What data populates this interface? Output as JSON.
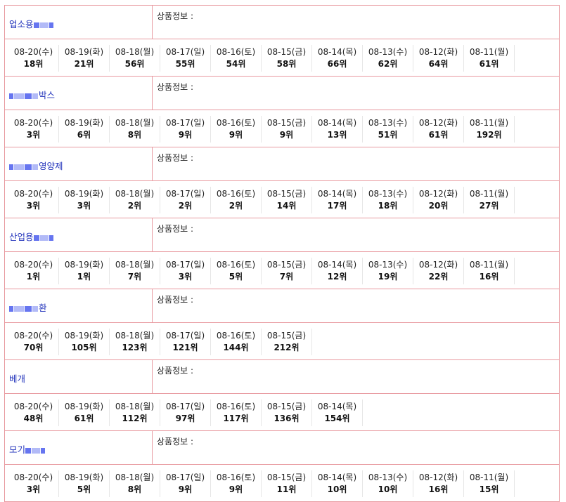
{
  "info_label": "상품정보 :",
  "blocks": [
    {
      "name": "업소용",
      "obscured_suffix": true,
      "ranks": [
        {
          "date": "08-20(수)",
          "rank": "18위"
        },
        {
          "date": "08-19(화)",
          "rank": "21위"
        },
        {
          "date": "08-18(월)",
          "rank": "56위"
        },
        {
          "date": "08-17(일)",
          "rank": "55위"
        },
        {
          "date": "08-16(토)",
          "rank": "54위"
        },
        {
          "date": "08-15(금)",
          "rank": "58위"
        },
        {
          "date": "08-14(목)",
          "rank": "66위"
        },
        {
          "date": "08-13(수)",
          "rank": "62위"
        },
        {
          "date": "08-12(화)",
          "rank": "64위"
        },
        {
          "date": "08-11(월)",
          "rank": "61위"
        }
      ]
    },
    {
      "name": "박스",
      "obscured_prefix": true,
      "ranks": [
        {
          "date": "08-20(수)",
          "rank": "3위"
        },
        {
          "date": "08-19(화)",
          "rank": "6위"
        },
        {
          "date": "08-18(월)",
          "rank": "8위"
        },
        {
          "date": "08-17(일)",
          "rank": "9위"
        },
        {
          "date": "08-16(토)",
          "rank": "9위"
        },
        {
          "date": "08-15(금)",
          "rank": "9위"
        },
        {
          "date": "08-14(목)",
          "rank": "13위"
        },
        {
          "date": "08-13(수)",
          "rank": "51위"
        },
        {
          "date": "08-12(화)",
          "rank": "61위"
        },
        {
          "date": "08-11(월)",
          "rank": "192위"
        }
      ]
    },
    {
      "name": "영양제",
      "obscured_prefix": true,
      "ranks": [
        {
          "date": "08-20(수)",
          "rank": "3위"
        },
        {
          "date": "08-19(화)",
          "rank": "3위"
        },
        {
          "date": "08-18(월)",
          "rank": "2위"
        },
        {
          "date": "08-17(일)",
          "rank": "2위"
        },
        {
          "date": "08-16(토)",
          "rank": "2위"
        },
        {
          "date": "08-15(금)",
          "rank": "14위"
        },
        {
          "date": "08-14(목)",
          "rank": "17위"
        },
        {
          "date": "08-13(수)",
          "rank": "18위"
        },
        {
          "date": "08-12(화)",
          "rank": "20위"
        },
        {
          "date": "08-11(월)",
          "rank": "27위"
        }
      ]
    },
    {
      "name": "산업용",
      "obscured_suffix": true,
      "ranks": [
        {
          "date": "08-20(수)",
          "rank": "1위"
        },
        {
          "date": "08-19(화)",
          "rank": "1위"
        },
        {
          "date": "08-18(월)",
          "rank": "7위"
        },
        {
          "date": "08-17(일)",
          "rank": "3위"
        },
        {
          "date": "08-16(토)",
          "rank": "5위"
        },
        {
          "date": "08-15(금)",
          "rank": "7위"
        },
        {
          "date": "08-14(목)",
          "rank": "12위"
        },
        {
          "date": "08-13(수)",
          "rank": "19위"
        },
        {
          "date": "08-12(화)",
          "rank": "22위"
        },
        {
          "date": "08-11(월)",
          "rank": "16위"
        }
      ]
    },
    {
      "name": "환",
      "obscured_prefix": true,
      "ranks": [
        {
          "date": "08-20(수)",
          "rank": "70위"
        },
        {
          "date": "08-19(화)",
          "rank": "105위"
        },
        {
          "date": "08-18(월)",
          "rank": "123위"
        },
        {
          "date": "08-17(일)",
          "rank": "121위"
        },
        {
          "date": "08-16(토)",
          "rank": "144위"
        },
        {
          "date": "08-15(금)",
          "rank": "212위"
        }
      ]
    },
    {
      "name": "베개",
      "ranks": [
        {
          "date": "08-20(수)",
          "rank": "48위"
        },
        {
          "date": "08-19(화)",
          "rank": "61위"
        },
        {
          "date": "08-18(월)",
          "rank": "112위"
        },
        {
          "date": "08-17(일)",
          "rank": "97위"
        },
        {
          "date": "08-16(토)",
          "rank": "117위"
        },
        {
          "date": "08-15(금)",
          "rank": "136위"
        },
        {
          "date": "08-14(목)",
          "rank": "154위"
        }
      ]
    },
    {
      "name": "모기",
      "obscured_suffix": true,
      "ranks": [
        {
          "date": "08-20(수)",
          "rank": "3위"
        },
        {
          "date": "08-19(화)",
          "rank": "5위"
        },
        {
          "date": "08-18(월)",
          "rank": "8위"
        },
        {
          "date": "08-17(일)",
          "rank": "9위"
        },
        {
          "date": "08-16(토)",
          "rank": "9위"
        },
        {
          "date": "08-15(금)",
          "rank": "11위"
        },
        {
          "date": "08-14(목)",
          "rank": "10위"
        },
        {
          "date": "08-13(수)",
          "rank": "10위"
        },
        {
          "date": "08-12(화)",
          "rank": "16위"
        },
        {
          "date": "08-11(월)",
          "rank": "15위"
        }
      ]
    }
  ],
  "colors": {
    "border": "#e89aa0",
    "product_name": "#2233bb",
    "redaction": "#5566ee"
  }
}
